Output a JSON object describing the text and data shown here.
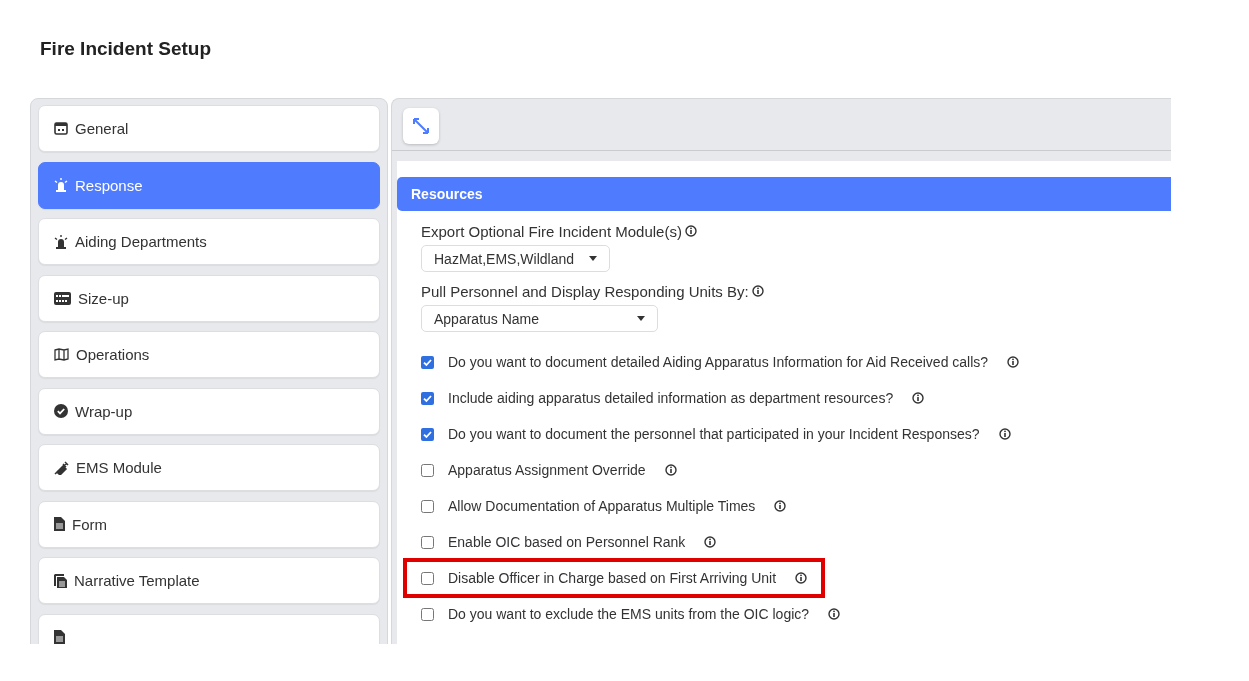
{
  "page_title": "Fire Incident Setup",
  "sidebar": {
    "items": [
      {
        "label": "General",
        "selected": false
      },
      {
        "label": "Response",
        "selected": true
      },
      {
        "label": "Aiding Departments",
        "selected": false
      },
      {
        "label": "Size-up",
        "selected": false
      },
      {
        "label": "Operations",
        "selected": false
      },
      {
        "label": "Wrap-up",
        "selected": false
      },
      {
        "label": "EMS Module",
        "selected": false
      },
      {
        "label": "Form",
        "selected": false
      },
      {
        "label": "Narrative Template",
        "selected": false
      },
      {
        "selected": false
      }
    ]
  },
  "content": {
    "section_title": "Resources",
    "selects": [
      {
        "label": "Export Optional Fire Incident Module(s)",
        "value": "HazMat,EMS,Wildland"
      },
      {
        "label": "Pull Personnel and Display Responding Units By:",
        "value": "Apparatus Name"
      }
    ],
    "options": [
      {
        "label": "Do you want to document detailed Aiding Apparatus Information for Aid Received calls?",
        "checked": true,
        "highlighted": false
      },
      {
        "label": "Include aiding apparatus detailed information as department resources?",
        "checked": true,
        "highlighted": false
      },
      {
        "label": "Do you want to document the personnel that participated in your Incident Responses?",
        "checked": true,
        "highlighted": false
      },
      {
        "label": "Apparatus Assignment Override",
        "checked": false,
        "highlighted": false
      },
      {
        "label": "Allow Documentation of Apparatus Multiple Times",
        "checked": false,
        "highlighted": false
      },
      {
        "label": "Enable OIC based on Personnel Rank",
        "checked": false,
        "highlighted": false
      },
      {
        "label": "Disable Officer in Charge based on First Arriving Unit",
        "checked": false,
        "highlighted": true
      },
      {
        "label": "Do you want to exclude the EMS units from the OIC logic?",
        "checked": false,
        "highlighted": false
      }
    ]
  }
}
